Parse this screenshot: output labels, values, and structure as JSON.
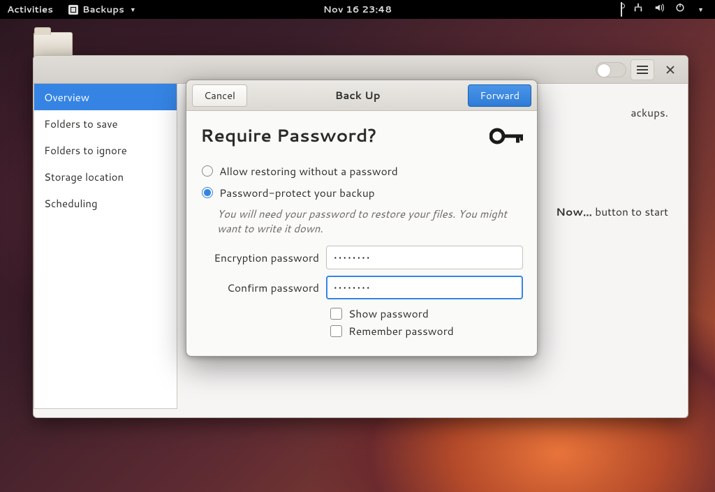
{
  "topbar": {
    "activities": "Activities",
    "app_name": "Backups",
    "datetime": "Nov 16  23:48"
  },
  "mainwin": {
    "sidebar": {
      "items": [
        {
          "label": "Overview",
          "active": true
        },
        {
          "label": "Folders to save",
          "active": false
        },
        {
          "label": "Folders to ignore",
          "active": false
        },
        {
          "label": "Storage location",
          "active": false
        },
        {
          "label": "Scheduling",
          "active": false
        }
      ]
    },
    "content": {
      "line1_suffix": "ackups.",
      "line2_button": "Now…",
      "line2_suffix": " button to start"
    }
  },
  "dialog": {
    "cancel": "Cancel",
    "title": "Back Up",
    "forward": "Forward",
    "heading": "Require Password?",
    "radio1": "Allow restoring without a password",
    "radio2": "Password-protect your backup",
    "hint": "You will need your password to restore your files. You might want to write it down.",
    "enc_label": "Encryption password",
    "conf_label": "Confirm password",
    "enc_value": "••••••••",
    "conf_value": "••••••••",
    "show_pw": "Show password",
    "remember_pw": "Remember password"
  }
}
